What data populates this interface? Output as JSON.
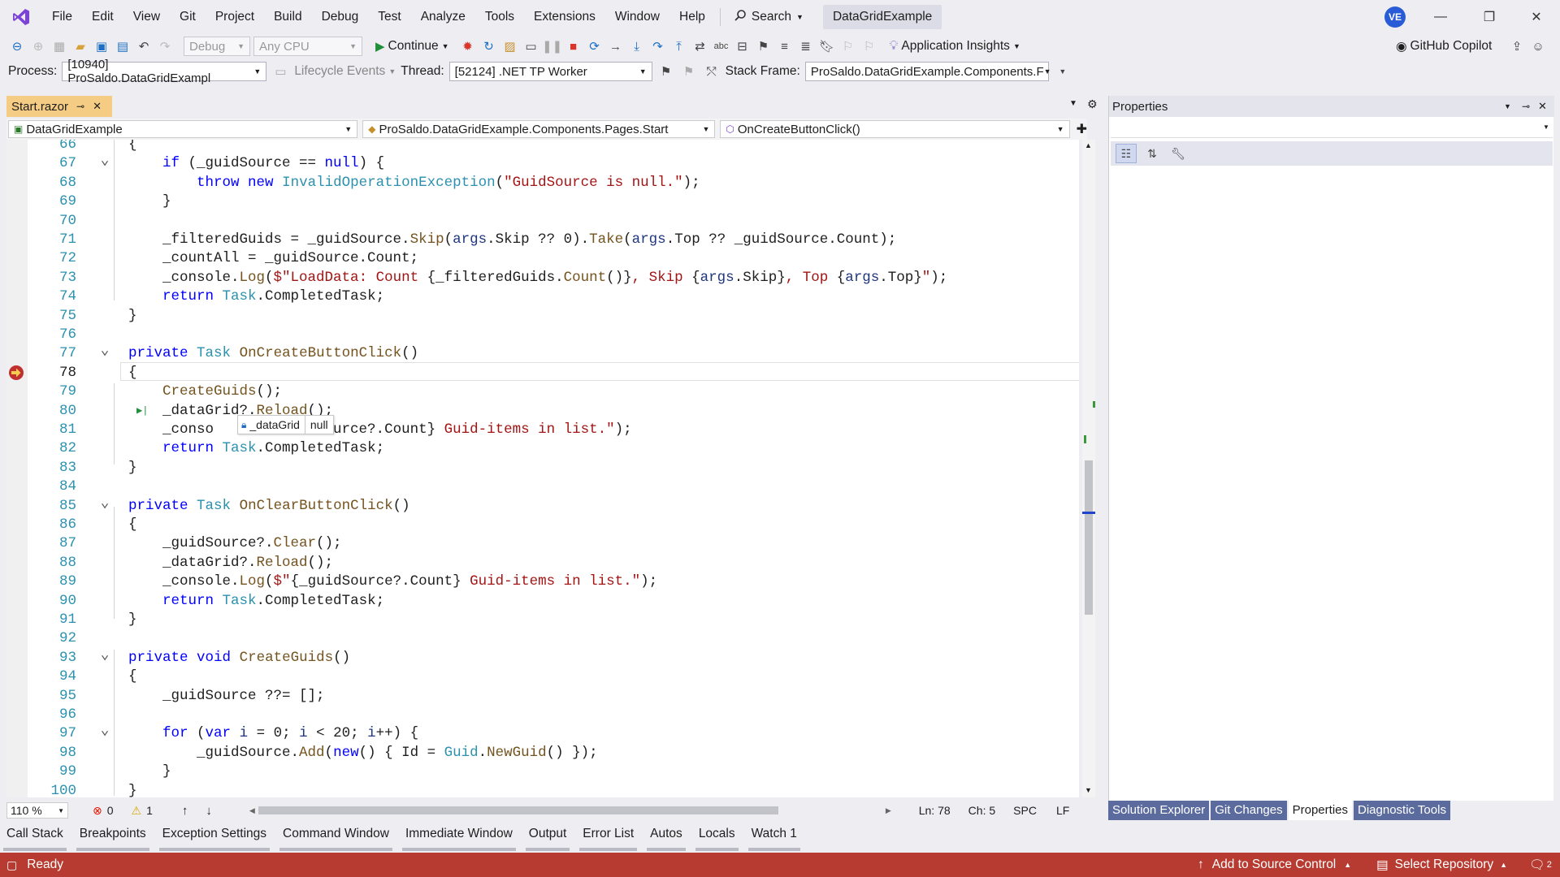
{
  "menu": {
    "items": [
      "File",
      "Edit",
      "View",
      "Git",
      "Project",
      "Build",
      "Debug",
      "Test",
      "Analyze",
      "Tools",
      "Extensions",
      "Window",
      "Help"
    ],
    "search_label": "Search",
    "solution_name": "DataGridExample",
    "avatar_initials": "VE"
  },
  "toolbar": {
    "config": "Debug",
    "platform": "Any CPU",
    "continue_label": "Continue",
    "app_insights": "Application Insights",
    "copilot": "GitHub Copilot"
  },
  "debug_toolbar": {
    "process_label": "Process:",
    "process_value": "[10940] ProSaldo.DataGridExampl",
    "lifecycle_label": "Lifecycle Events",
    "thread_label": "Thread:",
    "thread_value": "[52124] .NET TP Worker",
    "stack_label": "Stack Frame:",
    "stack_value": "ProSaldo.DataGridExample.Components.F"
  },
  "document": {
    "tab_title": "Start.razor",
    "nav_project": "DataGridExample",
    "nav_type": "ProSaldo.DataGridExample.Components.Pages.Start",
    "nav_member": "OnCreateButtonClick()"
  },
  "datatip": {
    "name": "_dataGrid",
    "value": "null"
  },
  "editor_status": {
    "zoom": "110 %",
    "errors": "0",
    "warnings": "1",
    "ln": "Ln: 78",
    "ch": "Ch: 5",
    "spc": "SPC",
    "lf": "LF"
  },
  "properties_panel": {
    "title": "Properties"
  },
  "right_tabs": [
    "Solution Explorer",
    "Git Changes",
    "Properties",
    "Diagnostic Tools"
  ],
  "tool_tabs": [
    "Call Stack",
    "Breakpoints",
    "Exception Settings",
    "Command Window",
    "Immediate Window",
    "Output",
    "Error List",
    "Autos",
    "Locals",
    "Watch 1"
  ],
  "status_bar": {
    "ready": "Ready",
    "add_source": "Add to Source Control",
    "select_repo": "Select Repository",
    "notifications": "2"
  },
  "code_lines": [
    {
      "n": "66",
      "indent": 0,
      "tokens": [
        [
          "p",
          "{"
        ]
      ]
    },
    {
      "n": "67",
      "indent": 1,
      "fold": true,
      "tokens": [
        [
          "kw",
          "if"
        ],
        [
          "p",
          " (_guidSource == "
        ],
        [
          "kw",
          "null"
        ],
        [
          "p",
          ") {"
        ]
      ]
    },
    {
      "n": "68",
      "indent": 2,
      "tokens": [
        [
          "kw",
          "throw"
        ],
        [
          "p",
          " "
        ],
        [
          "kw",
          "new"
        ],
        [
          "p",
          " "
        ],
        [
          "ty",
          "InvalidOperationException"
        ],
        [
          "p",
          "("
        ],
        [
          "str",
          "\"GuidSource is null.\""
        ],
        [
          "p",
          ");"
        ]
      ]
    },
    {
      "n": "69",
      "indent": 1,
      "tokens": [
        [
          "p",
          "}"
        ]
      ]
    },
    {
      "n": "70",
      "indent": 0,
      "tokens": []
    },
    {
      "n": "71",
      "indent": 1,
      "tokens": [
        [
          "p",
          "_filteredGuids = _guidSource."
        ],
        [
          "fn",
          "Skip"
        ],
        [
          "p",
          "("
        ],
        [
          "pr",
          "args"
        ],
        [
          "p",
          ".Skip ?? 0)."
        ],
        [
          "fn",
          "Take"
        ],
        [
          "p",
          "("
        ],
        [
          "pr",
          "args"
        ],
        [
          "p",
          ".Top ?? _guidSource.Count);"
        ]
      ]
    },
    {
      "n": "72",
      "indent": 1,
      "tokens": [
        [
          "p",
          "_countAll = _guidSource.Count;"
        ]
      ]
    },
    {
      "n": "73",
      "indent": 1,
      "tokens": [
        [
          "p",
          "_console."
        ],
        [
          "fn",
          "Log"
        ],
        [
          "p",
          "("
        ],
        [
          "str",
          "$\"LoadData: Count "
        ],
        [
          "p",
          "{_filteredGuids."
        ],
        [
          "fn",
          "Count"
        ],
        [
          "p",
          "()}"
        ],
        [
          "str",
          ", Skip "
        ],
        [
          "p",
          "{"
        ],
        [
          "pr",
          "args"
        ],
        [
          "p",
          ".Skip}"
        ],
        [
          "str",
          ", Top "
        ],
        [
          "p",
          "{"
        ],
        [
          "pr",
          "args"
        ],
        [
          "p",
          ".Top}"
        ],
        [
          "str",
          "\""
        ],
        [
          "p",
          ");"
        ]
      ]
    },
    {
      "n": "74",
      "indent": 1,
      "tokens": [
        [
          "kw",
          "return"
        ],
        [
          "p",
          " "
        ],
        [
          "ty",
          "Task"
        ],
        [
          "p",
          ".CompletedTask;"
        ]
      ]
    },
    {
      "n": "75",
      "indent": 0,
      "tokens": [
        [
          "p",
          "}"
        ]
      ]
    },
    {
      "n": "76",
      "indent": 0,
      "tokens": []
    },
    {
      "n": "77",
      "indent": 0,
      "fold": true,
      "tokens": [
        [
          "kw",
          "private"
        ],
        [
          "p",
          " "
        ],
        [
          "ty",
          "Task"
        ],
        [
          "p",
          " "
        ],
        [
          "fn",
          "OnCreateButtonClick"
        ],
        [
          "p",
          "()"
        ]
      ]
    },
    {
      "n": "78",
      "indent": 0,
      "current": true,
      "tokens": [
        [
          "p",
          "{"
        ]
      ]
    },
    {
      "n": "79",
      "indent": 1,
      "tokens": [
        [
          "fn",
          "CreateGuids"
        ],
        [
          "p",
          "();"
        ]
      ]
    },
    {
      "n": "80",
      "indent": 1,
      "runto": true,
      "tokens": [
        [
          "p",
          "_dataGrid?."
        ],
        [
          "fn",
          "Reload"
        ],
        [
          "p",
          "();"
        ]
      ]
    },
    {
      "n": "81",
      "indent": 1,
      "tokens": [
        [
          "p",
          "_conso"
        ],
        [
          "p",
          "          "
        ],
        [
          "p",
          "idSource?.Count}"
        ],
        [
          "str",
          " Guid-items in list.\""
        ],
        [
          "p",
          ");"
        ]
      ]
    },
    {
      "n": "82",
      "indent": 1,
      "tokens": [
        [
          "kw",
          "return"
        ],
        [
          "p",
          " "
        ],
        [
          "ty",
          "Task"
        ],
        [
          "p",
          ".CompletedTask;"
        ]
      ]
    },
    {
      "n": "83",
      "indent": 0,
      "tokens": [
        [
          "p",
          "}"
        ]
      ]
    },
    {
      "n": "84",
      "indent": 0,
      "tokens": []
    },
    {
      "n": "85",
      "indent": 0,
      "fold": true,
      "tokens": [
        [
          "kw",
          "private"
        ],
        [
          "p",
          " "
        ],
        [
          "ty",
          "Task"
        ],
        [
          "p",
          " "
        ],
        [
          "fn",
          "OnClearButtonClick"
        ],
        [
          "p",
          "()"
        ]
      ]
    },
    {
      "n": "86",
      "indent": 0,
      "tokens": [
        [
          "p",
          "{"
        ]
      ]
    },
    {
      "n": "87",
      "indent": 1,
      "tokens": [
        [
          "p",
          "_guidSource?."
        ],
        [
          "fn",
          "Clear"
        ],
        [
          "p",
          "();"
        ]
      ]
    },
    {
      "n": "88",
      "indent": 1,
      "tokens": [
        [
          "p",
          "_dataGrid?."
        ],
        [
          "fn",
          "Reload"
        ],
        [
          "p",
          "();"
        ]
      ]
    },
    {
      "n": "89",
      "indent": 1,
      "tokens": [
        [
          "p",
          "_console."
        ],
        [
          "fn",
          "Log"
        ],
        [
          "p",
          "("
        ],
        [
          "str",
          "$\""
        ],
        [
          "p",
          "{_guidSource?.Count}"
        ],
        [
          "str",
          " Guid-items in list.\""
        ],
        [
          "p",
          ");"
        ]
      ]
    },
    {
      "n": "90",
      "indent": 1,
      "tokens": [
        [
          "kw",
          "return"
        ],
        [
          "p",
          " "
        ],
        [
          "ty",
          "Task"
        ],
        [
          "p",
          ".CompletedTask;"
        ]
      ]
    },
    {
      "n": "91",
      "indent": 0,
      "tokens": [
        [
          "p",
          "}"
        ]
      ]
    },
    {
      "n": "92",
      "indent": 0,
      "tokens": []
    },
    {
      "n": "93",
      "indent": 0,
      "fold": true,
      "tokens": [
        [
          "kw",
          "private"
        ],
        [
          "p",
          " "
        ],
        [
          "kw",
          "void"
        ],
        [
          "p",
          " "
        ],
        [
          "fn",
          "CreateGuids"
        ],
        [
          "p",
          "()"
        ]
      ]
    },
    {
      "n": "94",
      "indent": 0,
      "tokens": [
        [
          "p",
          "{"
        ]
      ]
    },
    {
      "n": "95",
      "indent": 1,
      "tokens": [
        [
          "p",
          "_guidSource ??= [];"
        ]
      ]
    },
    {
      "n": "96",
      "indent": 0,
      "tokens": []
    },
    {
      "n": "97",
      "indent": 1,
      "fold": true,
      "tokens": [
        [
          "kw",
          "for"
        ],
        [
          "p",
          " ("
        ],
        [
          "kw",
          "var"
        ],
        [
          "p",
          " "
        ],
        [
          "pr",
          "i"
        ],
        [
          "p",
          " = 0; "
        ],
        [
          "pr",
          "i"
        ],
        [
          "p",
          " < 20; "
        ],
        [
          "pr",
          "i"
        ],
        [
          "p",
          "++) {"
        ]
      ]
    },
    {
      "n": "98",
      "indent": 2,
      "tokens": [
        [
          "p",
          "_guidSource."
        ],
        [
          "fn",
          "Add"
        ],
        [
          "p",
          "("
        ],
        [
          "kw",
          "new"
        ],
        [
          "p",
          "() { Id = "
        ],
        [
          "ty",
          "Guid"
        ],
        [
          "p",
          "."
        ],
        [
          "fn",
          "NewGuid"
        ],
        [
          "p",
          "() });"
        ]
      ]
    },
    {
      "n": "99",
      "indent": 1,
      "tokens": [
        [
          "p",
          "}"
        ]
      ]
    },
    {
      "n": "100",
      "indent": 0,
      "tokens": [
        [
          "p",
          "}"
        ]
      ]
    }
  ]
}
